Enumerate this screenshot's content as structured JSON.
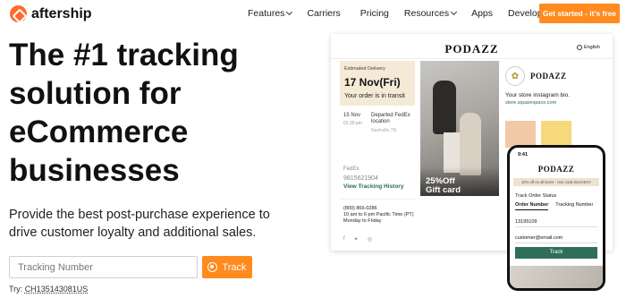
{
  "nav": {
    "logo": "aftership",
    "links": [
      {
        "label": "Features",
        "dropdown": true
      },
      {
        "label": "Carriers",
        "dropdown": false
      },
      {
        "label": "Pricing",
        "dropdown": false
      },
      {
        "label": "Resources",
        "dropdown": true
      },
      {
        "label": "Apps",
        "dropdown": false
      },
      {
        "label": "Developers",
        "dropdown": false
      }
    ],
    "cta": "Get started - it's free"
  },
  "hero": {
    "title": "The #1 tracking solution for eCommerce businesses",
    "subtitle": "Provide the best post-purchase experience to drive customer loyalty and additional sales."
  },
  "tracking": {
    "placeholder": "Tracking Number",
    "button": "Track",
    "try_label": "Try:",
    "try_number": "CH135143081US"
  },
  "preview": {
    "brand": "PODAZZ",
    "language": "English",
    "delivery_label": "Estimated Delivery",
    "delivery_date": "17 Nov(Fri)",
    "delivery_status": "Your order is in transit",
    "event_date": "15 Nov",
    "event_time": "01:30 pm",
    "event_text": "Departed FedEx location",
    "event_location": "Nashville,TN",
    "carrier": "FedEx",
    "carrier_number": "9815621904",
    "history_link": "View Tracking History",
    "contact_phone": "(800) 866-0286",
    "contact_hours": "10 am to 6 pm Pacific Time (PT)",
    "contact_days": "Monday to Friday",
    "promo_title": "25%Off",
    "promo_sub": "Gift card",
    "ig_bio": "Your store instagram bio.",
    "ig_url": "store.squarespace.com",
    "socials": [
      "f",
      "✦",
      "◎"
    ]
  },
  "phone": {
    "time": "9:41",
    "brand": "PODAZZ",
    "promo": "10% off on all items - Use code BLKSDAY",
    "track_title": "Track Order Status",
    "tab_order": "Order Number",
    "tab_tracking": "Tracking Number",
    "order_value": "13195109",
    "email_value": "customer@email.com",
    "track_button": "Track"
  },
  "colors": {
    "accent": "#ff8a1f",
    "brand_green": "#2f6e5b"
  }
}
